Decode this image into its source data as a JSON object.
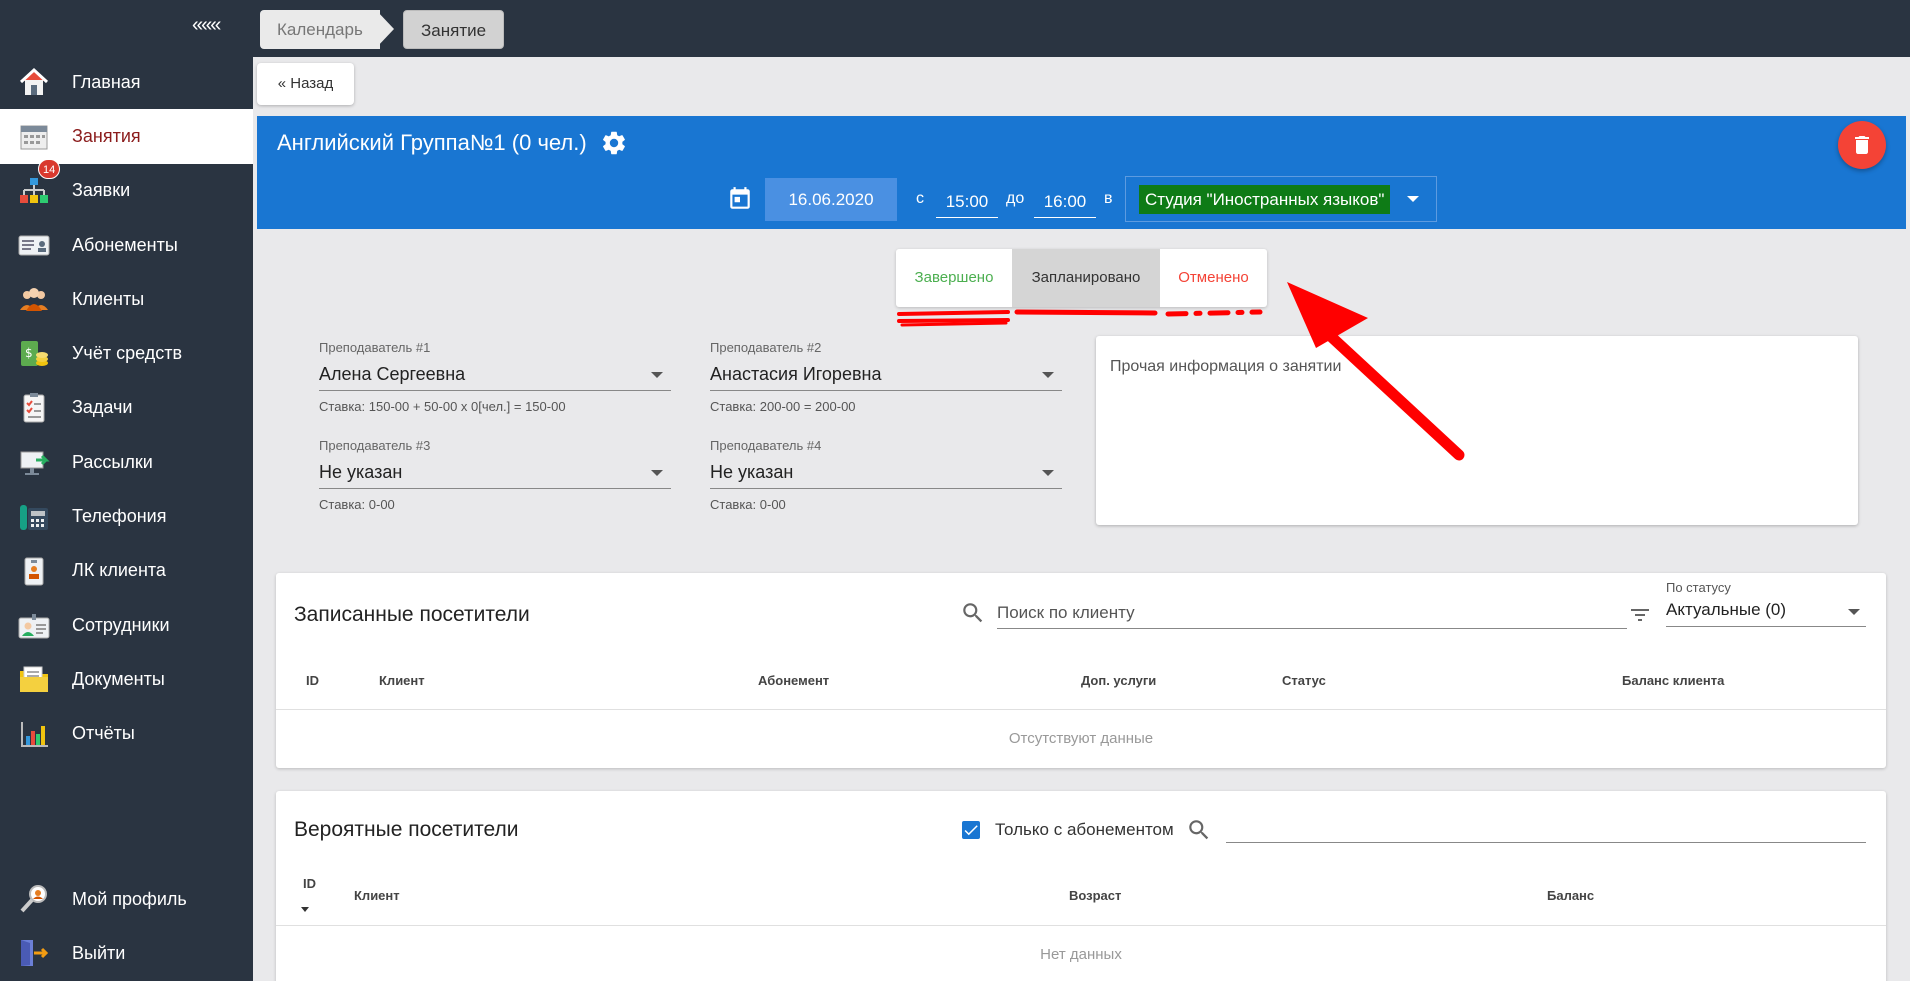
{
  "sidebar": {
    "collapse_label": "«««",
    "items": [
      {
        "label": "Главная",
        "icon": "home-icon"
      },
      {
        "label": "Занятия",
        "icon": "calendar-icon",
        "active": true
      },
      {
        "label": "Заявки",
        "icon": "requests-icon",
        "badge": "14"
      },
      {
        "label": "Абонементы",
        "icon": "subscription-card-icon"
      },
      {
        "label": "Клиенты",
        "icon": "clients-icon"
      },
      {
        "label": "Учёт средств",
        "icon": "money-icon"
      },
      {
        "label": "Задачи",
        "icon": "checklist-icon"
      },
      {
        "label": "Рассылки",
        "icon": "mailing-icon"
      },
      {
        "label": "Телефония",
        "icon": "phone-icon"
      },
      {
        "label": "ЛК клиента",
        "icon": "client-account-icon"
      },
      {
        "label": "Сотрудники",
        "icon": "employees-icon"
      },
      {
        "label": "Документы",
        "icon": "documents-icon"
      },
      {
        "label": "Отчёты",
        "icon": "reports-icon"
      }
    ],
    "bottom_items": [
      {
        "label": "Мой профиль",
        "icon": "profile-icon"
      },
      {
        "label": "Выйти",
        "icon": "logout-icon"
      }
    ]
  },
  "breadcrumbs": [
    "Календарь",
    "Занятие"
  ],
  "back_label": "« Назад",
  "lesson": {
    "title": "Английский Группа№1 (0 чел.)",
    "date": "16.06.2020",
    "from_label": "с",
    "time_from": "15:00",
    "to_label": "до",
    "time_to": "16:00",
    "in_label": "в",
    "room": "Студия \"Иностранных языков\"",
    "room_color": "#0e7b16",
    "header_color": "#1976d2"
  },
  "status": {
    "done": "Завершено",
    "planned": "Запланировано",
    "cancelled": "Отменено",
    "selected": "planned"
  },
  "teachers": [
    {
      "label": "Преподаватель #1",
      "value": "Алена Сергеевна",
      "rate": "Ставка: 150-00 + 50-00 x 0[чел.] = 150-00"
    },
    {
      "label": "Преподаватель #2",
      "value": "Анастасия Игоревна",
      "rate": "Ставка: 200-00 = 200-00"
    },
    {
      "label": "Преподаватель #3",
      "value": "Не указан",
      "rate": "Ставка: 0-00"
    },
    {
      "label": "Преподаватель #4",
      "value": "Не указан",
      "rate": "Ставка: 0-00"
    }
  ],
  "notes_placeholder": "Прочая информация о занятии",
  "registered": {
    "title": "Записанные посетители",
    "search_placeholder": "Поиск по клиенту",
    "status_filter_label": "По статусу",
    "status_filter_value": "Актуальные (0)",
    "columns": [
      "ID",
      "Клиент",
      "Абонемент",
      "Доп. услуги",
      "Статус",
      "Баланс клиента"
    ],
    "empty": "Отсутствуют данные"
  },
  "probable": {
    "title": "Вероятные посетители",
    "only_subscription_label": "Только с абонементом",
    "only_subscription_checked": true,
    "columns": [
      "ID",
      "Клиент",
      "Возраст",
      "Баланс"
    ],
    "empty": "Нет данных"
  }
}
